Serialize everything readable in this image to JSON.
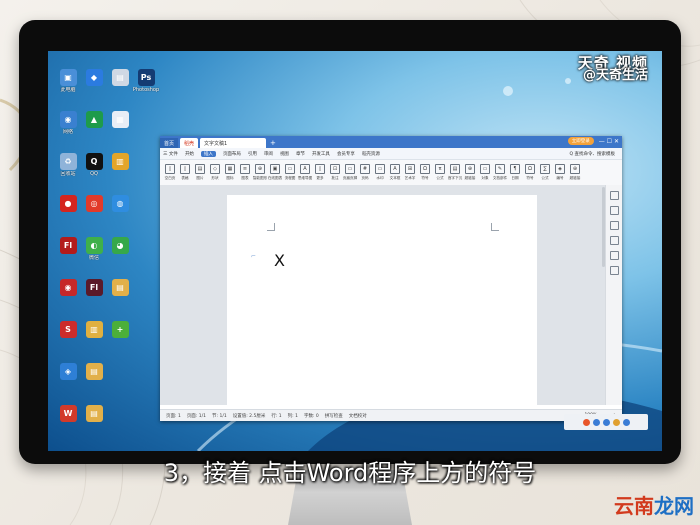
{
  "watermark": {
    "top": "天奇 视频",
    "bottom": "@天奇生活"
  },
  "desktop_icons": [
    {
      "label": "此电脑",
      "color": "#4a8fd8",
      "glyph": "▣"
    },
    {
      "label": "",
      "color": "#2b7be0",
      "glyph": "◆"
    },
    {
      "label": "",
      "color": "#cfd8e4",
      "glyph": "▤"
    },
    {
      "label": "Photoshop",
      "color": "#143b73",
      "glyph": "Ps"
    },
    {
      "label": "网络",
      "color": "#3a80d0",
      "glyph": "◉"
    },
    {
      "label": "",
      "color": "#1e9b4a",
      "glyph": "▲"
    },
    {
      "label": "",
      "color": "#e8eef6",
      "glyph": "▦"
    },
    {
      "label": "回收站",
      "color": "#8fb3d9",
      "glyph": "♻"
    },
    {
      "label": "QQ",
      "color": "#111111",
      "glyph": "Q"
    },
    {
      "label": "",
      "color": "#e3a52a",
      "glyph": "▥"
    },
    {
      "label": "",
      "color": "#d4251f",
      "glyph": "●"
    },
    {
      "label": "",
      "color": "#e23a2a",
      "glyph": "◎"
    },
    {
      "label": "",
      "color": "#2f8de0",
      "glyph": "◍"
    },
    {
      "label": "",
      "color": "#b31b1b",
      "glyph": "Fl"
    },
    {
      "label": "微信",
      "color": "#3fb04a",
      "glyph": "◐"
    },
    {
      "label": "",
      "color": "#36a84a",
      "glyph": "◕"
    },
    {
      "label": "",
      "color": "#c62828",
      "glyph": "◉"
    },
    {
      "label": "",
      "color": "#5a1a2a",
      "glyph": "Fl"
    },
    {
      "label": "",
      "color": "#e2b04a",
      "glyph": "▤"
    },
    {
      "label": "",
      "color": "#cc2c2c",
      "glyph": "S"
    },
    {
      "label": "",
      "color": "#e0b040",
      "glyph": "▥"
    },
    {
      "label": "",
      "color": "#4caf3a",
      "glyph": "+"
    },
    {
      "label": "",
      "color": "#2e7fd6",
      "glyph": "◈"
    },
    {
      "label": "",
      "color": "#e2b04a",
      "glyph": "▤"
    },
    {
      "label": "",
      "color": "#d23a2a",
      "glyph": "W"
    },
    {
      "label": "",
      "color": "#e2b04a",
      "glyph": "▤"
    }
  ],
  "wps": {
    "tabs": {
      "home": "首页",
      "str": "稻壳",
      "doc": "文字文稿1",
      "add": "+"
    },
    "login": "立即登录",
    "window_controls": "— ☐ ✕",
    "menu": [
      "三 文件",
      "开始",
      "插入",
      "页面布局",
      "引用",
      "审阅",
      "视图",
      "章节",
      "开发工具",
      "会员专享",
      "稻壳资源"
    ],
    "menu_active_index": 2,
    "menu_right": "Q 查找命令、搜索模板",
    "ribbon": [
      {
        "g": "▯",
        "t": "空白页"
      },
      {
        "g": "▯",
        "t": "表格"
      },
      {
        "g": "▤",
        "t": "图片"
      },
      {
        "g": "◇",
        "t": "形状"
      },
      {
        "g": "▦",
        "t": "图标"
      },
      {
        "g": "≡",
        "t": "图表"
      },
      {
        "g": "⊕",
        "t": "智能图形"
      },
      {
        "g": "▣",
        "t": "在线图表"
      },
      {
        "g": "▭",
        "t": "流程图"
      },
      {
        "g": "A",
        "t": "思维导图"
      },
      {
        "g": "▯",
        "t": "更多"
      },
      {
        "g": "⊡",
        "t": "批注"
      },
      {
        "g": "▭",
        "t": "页眉页脚"
      },
      {
        "g": "#",
        "t": "页码"
      },
      {
        "g": "▭",
        "t": "水印"
      },
      {
        "g": "A",
        "t": "文本框"
      },
      {
        "g": "⊞",
        "t": "艺术字"
      },
      {
        "g": "Ω",
        "t": "符号"
      },
      {
        "g": "π",
        "t": "公式"
      },
      {
        "g": "▤",
        "t": "首字下沉"
      },
      {
        "g": "⊕",
        "t": "超链接"
      },
      {
        "g": "▭",
        "t": "对象"
      },
      {
        "g": "✎",
        "t": "文档部件"
      },
      {
        "g": "¶",
        "t": "日期"
      },
      {
        "g": "Ω",
        "t": "符号"
      },
      {
        "g": "∑",
        "t": "公式"
      },
      {
        "g": "◈",
        "t": "编号"
      },
      {
        "g": "⊕",
        "t": "超链接"
      }
    ],
    "doc_text": "X",
    "status": [
      "页面: 1",
      "页面: 1/1",
      "节: 1/1",
      "设置值: 2.5厘米",
      "行: 1",
      "列: 1",
      "字数: 0",
      "拼写检查",
      "文档校对"
    ],
    "zoom": "100% - —— +"
  },
  "caption": "3，接着 点击Word程序上方的符号",
  "site_logo": {
    "main": "云南",
    "accent": "龙网"
  }
}
